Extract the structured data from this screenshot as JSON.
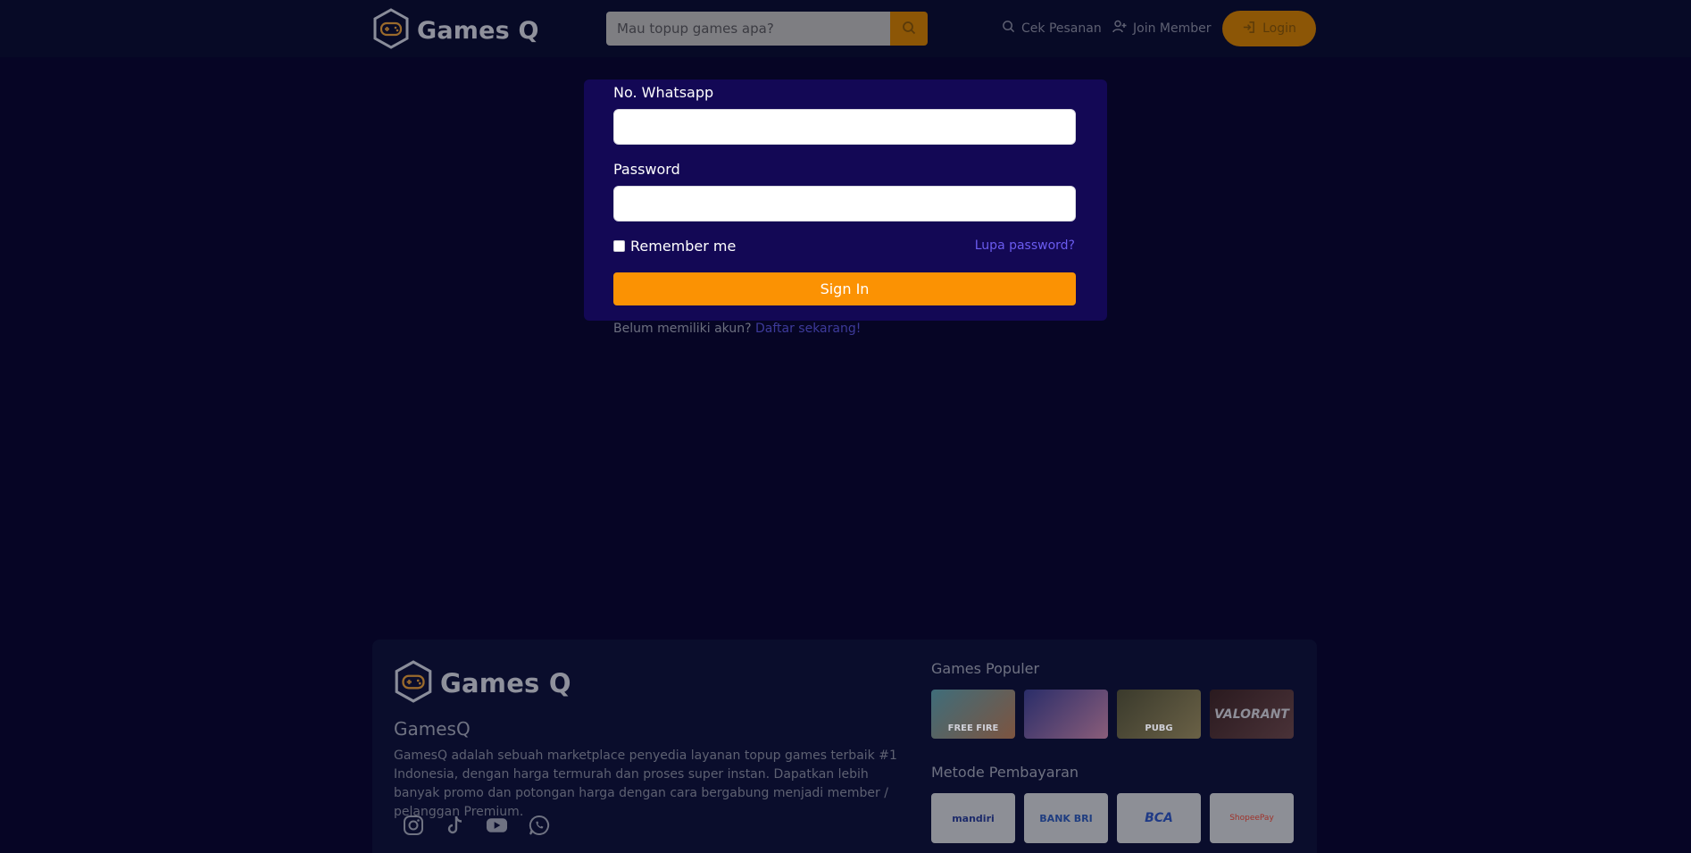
{
  "header": {
    "brand": "Games Q",
    "search_placeholder": "Mau topup games apa?",
    "nav": {
      "cek_pesanan": "Cek Pesanan",
      "join_member": "Join Member",
      "login": "Login"
    }
  },
  "login_form": {
    "whatsapp_label": "No. Whatsapp",
    "password_label": "Password",
    "remember_label": "Remember me",
    "remember_checked": false,
    "forgot_link": "Lupa password?",
    "signin_label": "Sign In",
    "register_prompt": "Belum memiliki akun?",
    "register_link": "Daftar sekarang!"
  },
  "footer": {
    "brand": "Games Q",
    "title": "GamesQ",
    "description": "GamesQ adalah sebuah marketplace penyedia layanan topup games terbaik #1 Indonesia, dengan harga termurah dan proses super instan. Dapatkan lebih banyak promo dan potongan harga dengan cara bergabung menjadi member / pelanggan Premium.",
    "socials": [
      "instagram-icon",
      "tiktok-icon",
      "youtube-icon",
      "whatsapp-icon"
    ],
    "popular_games_title": "Games Populer",
    "popular_games": [
      {
        "icon": "free-fire-thumbnail",
        "label": "FREE FIRE"
      },
      {
        "icon": "mobile-legends-thumbnail",
        "label": ""
      },
      {
        "icon": "pubg-thumbnail",
        "label": "PUBG"
      },
      {
        "icon": "valorant-thumbnail",
        "label": "VALORANT"
      }
    ],
    "payment_title": "Metode Pembayaran",
    "payments": [
      "mandiri",
      "BANK BRI",
      "BCA",
      "ShopeePay"
    ]
  },
  "colors": {
    "background": "#060525",
    "card": "#130855",
    "accent": "#fb9203",
    "link": "#6b5cf0"
  }
}
